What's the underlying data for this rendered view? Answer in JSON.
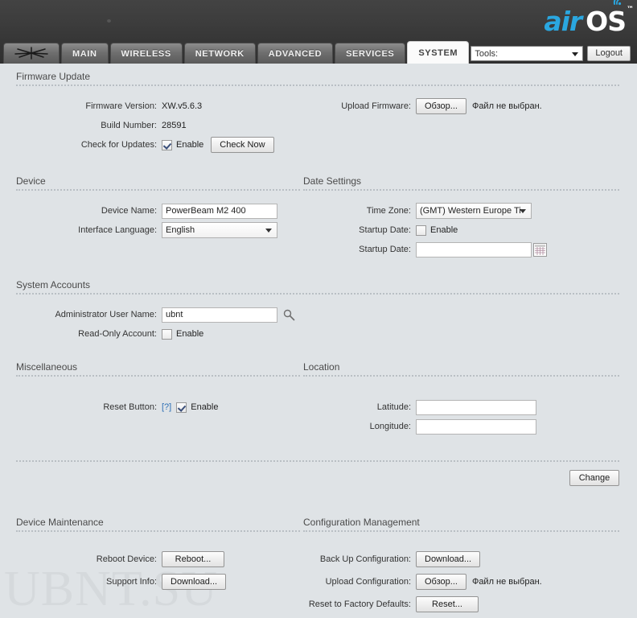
{
  "header": {
    "logo_air": "air",
    "logo_os": "OS",
    "logo_tm": "™"
  },
  "tabs": [
    {
      "id": "logo",
      "label": "",
      "icon": "ubiquiti-logo-icon",
      "active": false
    },
    {
      "id": "main",
      "label": "MAIN",
      "active": false
    },
    {
      "id": "wireless",
      "label": "WIRELESS",
      "active": false
    },
    {
      "id": "network",
      "label": "NETWORK",
      "active": false
    },
    {
      "id": "advanced",
      "label": "ADVANCED",
      "active": false
    },
    {
      "id": "services",
      "label": "SERVICES",
      "active": false
    },
    {
      "id": "system",
      "label": "SYSTEM",
      "active": true
    }
  ],
  "toolbar": {
    "tools_label": "Tools:",
    "logout_label": "Logout"
  },
  "firmware_update": {
    "title": "Firmware Update",
    "firmware_version_label": "Firmware Version:",
    "firmware_version_value": "XW.v5.6.3",
    "build_number_label": "Build Number:",
    "build_number_value": "28591",
    "check_for_updates_label": "Check for Updates:",
    "check_for_updates_enable": "Enable",
    "check_for_updates_checked": true,
    "check_now_label": "Check Now",
    "upload_firmware_label": "Upload Firmware:",
    "upload_firmware_browse": "Обзор...",
    "upload_firmware_nofile": "Файл не выбран."
  },
  "device": {
    "title": "Device",
    "device_name_label": "Device Name:",
    "device_name_value": "PowerBeam M2 400",
    "interface_language_label": "Interface Language:",
    "interface_language_value": "English"
  },
  "date_settings": {
    "title": "Date Settings",
    "time_zone_label": "Time Zone:",
    "time_zone_value": "(GMT) Western Europe Ti",
    "startup_date_enable_label": "Startup Date:",
    "startup_date_enable_text": "Enable",
    "startup_date_checked": false,
    "startup_date_field_label": "Startup Date:",
    "startup_date_field_value": "",
    "calendar_icon": "calendar-icon"
  },
  "system_accounts": {
    "title": "System Accounts",
    "admin_user_name_label": "Administrator User Name:",
    "admin_user_name_value": "ubnt",
    "admin_key_icon": "key-magnifier-icon",
    "read_only_account_label": "Read-Only Account:",
    "read_only_enable_text": "Enable",
    "read_only_checked": false
  },
  "miscellaneous": {
    "title": "Miscellaneous",
    "reset_button_label": "Reset Button:",
    "reset_button_help": "[?]",
    "reset_button_enable_text": "Enable",
    "reset_button_checked": true
  },
  "location": {
    "title": "Location",
    "latitude_label": "Latitude:",
    "latitude_value": "",
    "longitude_label": "Longitude:",
    "longitude_value": ""
  },
  "apply": {
    "change_label": "Change"
  },
  "device_maintenance": {
    "title": "Device Maintenance",
    "reboot_device_label": "Reboot Device:",
    "reboot_button": "Reboot...",
    "support_info_label": "Support Info:",
    "support_download_button": "Download..."
  },
  "configuration_management": {
    "title": "Configuration Management",
    "backup_label": "Back Up Configuration:",
    "backup_button": "Download...",
    "upload_label": "Upload Configuration:",
    "upload_browse_button": "Обзор...",
    "upload_nofile": "Файл не выбран.",
    "reset_defaults_label": "Reset to Factory Defaults:",
    "reset_button": "Reset..."
  },
  "watermark": {
    "text": "UBNT.SU"
  },
  "colors": {
    "accent_blue": "#2aa7e0",
    "link_blue": "#2d6fb5",
    "page_bg": "#dfe3e6",
    "header_bg": "#3d3d3d"
  }
}
